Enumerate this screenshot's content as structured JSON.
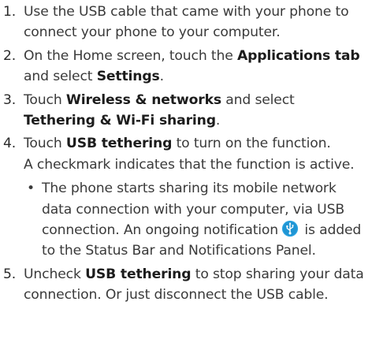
{
  "steps": [
    {
      "number": "1.",
      "text": "Use the USB cable that came with your phone to connect your phone to your computer."
    },
    {
      "number": "2.",
      "pre": "On the Home screen, touch the ",
      "bold1": "Applications tab",
      "mid": " and select ",
      "bold2": "Settings",
      "post": "."
    },
    {
      "number": "3.",
      "pre": "Touch ",
      "bold1": "Wireless & networks",
      "mid": " and select ",
      "bold2": "Tethering & Wi-Fi sharing",
      "post": "."
    },
    {
      "number": "4.",
      "pre": "Touch ",
      "bold1": "USB tethering",
      "post": " to turn on the function.",
      "line2": "A checkmark indicates that the function is active.",
      "bullet_mark": "•",
      "bullet_pre": "The phone starts sharing its mobile network data connection with your computer, via USB connection. An ongoing notification",
      "bullet_post": "is added to the Status Bar and Notifications Panel."
    },
    {
      "number": "5.",
      "pre": "Uncheck ",
      "bold1": "USB tethering",
      "post": " to stop sharing your data connection. Or just disconnect the USB cable."
    }
  ],
  "icons": {
    "usb_notification_icon": "usb-icon"
  },
  "colors": {
    "text": "#3a3a3a",
    "icon_blue": "#2aa3e0"
  }
}
